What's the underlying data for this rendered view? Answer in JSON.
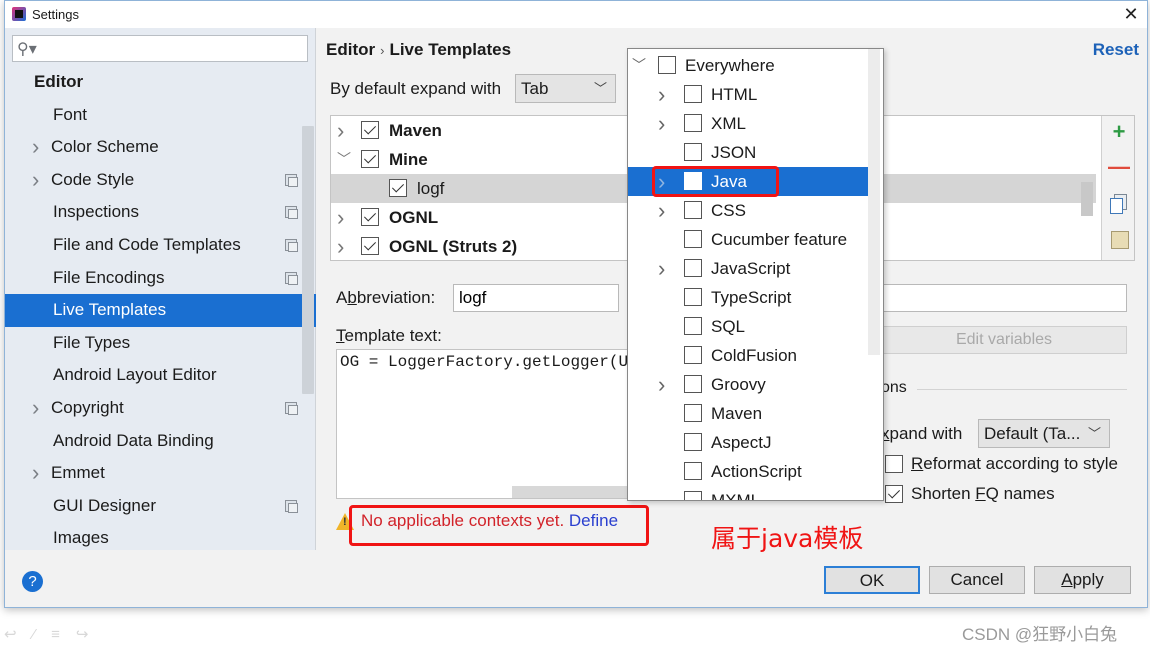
{
  "window": {
    "title": "Settings",
    "close_glyph": "✕"
  },
  "sidebar": {
    "search_placeholder": "",
    "search_icon": "search-icon",
    "items": [
      {
        "label": "Editor",
        "type": "header"
      },
      {
        "label": "Font",
        "type": "child"
      },
      {
        "label": "Color Scheme",
        "type": "expandable"
      },
      {
        "label": "Code Style",
        "type": "expandable",
        "project_icon": true
      },
      {
        "label": "Inspections",
        "type": "child",
        "project_icon": true
      },
      {
        "label": "File and Code Templates",
        "type": "child",
        "project_icon": true
      },
      {
        "label": "File Encodings",
        "type": "child",
        "project_icon": true
      },
      {
        "label": "Live Templates",
        "type": "child",
        "selected": true
      },
      {
        "label": "File Types",
        "type": "child"
      },
      {
        "label": "Android Layout Editor",
        "type": "child"
      },
      {
        "label": "Copyright",
        "type": "expandable",
        "project_icon": true
      },
      {
        "label": "Android Data Binding",
        "type": "child"
      },
      {
        "label": "Emmet",
        "type": "expandable"
      },
      {
        "label": "GUI Designer",
        "type": "child",
        "project_icon": true
      },
      {
        "label": "Images",
        "type": "child"
      }
    ]
  },
  "header": {
    "breadcrumb_parent": "Editor",
    "breadcrumb_sep": "›",
    "breadcrumb_current": "Live Templates",
    "reset_label": "Reset"
  },
  "expand": {
    "label": "By default expand with",
    "value": "Tab"
  },
  "template_groups": [
    {
      "label": "Maven",
      "checked": true,
      "expanded": false,
      "group": true
    },
    {
      "label": "Mine",
      "checked": true,
      "expanded": true,
      "group": true
    },
    {
      "label": "logf",
      "checked": true,
      "group": false,
      "selected": true
    },
    {
      "label": "OGNL",
      "checked": true,
      "expanded": false,
      "group": true
    },
    {
      "label": "OGNL (Struts 2)",
      "checked": true,
      "expanded": false,
      "group": true
    }
  ],
  "toolbar": {
    "add": "+",
    "remove": "—"
  },
  "editor": {
    "abbreviation_label_pre": "A",
    "abbreviation_label_mn": "b",
    "abbreviation_label_post": "breviation:",
    "abbreviation_value": "logf",
    "description_value": "",
    "template_text_label_mn": "T",
    "template_text_label_post": "emplate text:",
    "template_text": "OG = LoggerFactory.getLogger(U",
    "edit_variables_label": "Edit variables"
  },
  "options": {
    "section_label": "ons",
    "expand_label_mn": "x",
    "expand_label_post": "pand with",
    "expand_value": "Default (Ta...",
    "reformat_mn": "R",
    "reformat_post": "eformat according to style",
    "reformat_checked": false,
    "shorten_pre": "Shorten ",
    "shorten_mn": "F",
    "shorten_post": "Q names",
    "shorten_checked": true
  },
  "warning": {
    "text": "No applicable contexts yet. ",
    "link": "Define"
  },
  "context_popup": {
    "items": [
      {
        "label": "Everywhere",
        "level": 0,
        "chevron": "down",
        "checked": false
      },
      {
        "label": "HTML",
        "level": 1,
        "chevron": "right",
        "checked": false
      },
      {
        "label": "XML",
        "level": 1,
        "chevron": "right",
        "checked": false
      },
      {
        "label": "JSON",
        "level": 1,
        "chevron": "",
        "checked": false
      },
      {
        "label": "Java",
        "level": 1,
        "chevron": "right",
        "checked": false,
        "selected": true
      },
      {
        "label": "CSS",
        "level": 1,
        "chevron": "right",
        "checked": false
      },
      {
        "label": "Cucumber feature",
        "level": 1,
        "chevron": "",
        "checked": false
      },
      {
        "label": "JavaScript",
        "level": 1,
        "chevron": "right",
        "checked": false
      },
      {
        "label": "TypeScript",
        "level": 1,
        "chevron": "",
        "checked": false
      },
      {
        "label": "SQL",
        "level": 1,
        "chevron": "",
        "checked": false
      },
      {
        "label": "ColdFusion",
        "level": 1,
        "chevron": "",
        "checked": false
      },
      {
        "label": "Groovy",
        "level": 1,
        "chevron": "right",
        "checked": false
      },
      {
        "label": "Maven",
        "level": 1,
        "chevron": "",
        "checked": false
      },
      {
        "label": "AspectJ",
        "level": 1,
        "chevron": "",
        "checked": false
      },
      {
        "label": "ActionScript",
        "level": 1,
        "chevron": "",
        "checked": false
      },
      {
        "label": "MXML",
        "level": 1,
        "chevron": "",
        "checked": false
      }
    ]
  },
  "annotation": "属于java模板",
  "footer": {
    "help": "?",
    "ok": "OK",
    "cancel": "Cancel",
    "apply_mn": "A",
    "apply_post": "pply"
  },
  "watermark": "CSDN @狂野小白兔",
  "colors": {
    "accent": "#1a6fd1",
    "annotation_red": "#f01414",
    "warning_red": "#d2232a",
    "link_blue": "#2a3fcf",
    "reset_blue": "#1d62b8"
  }
}
